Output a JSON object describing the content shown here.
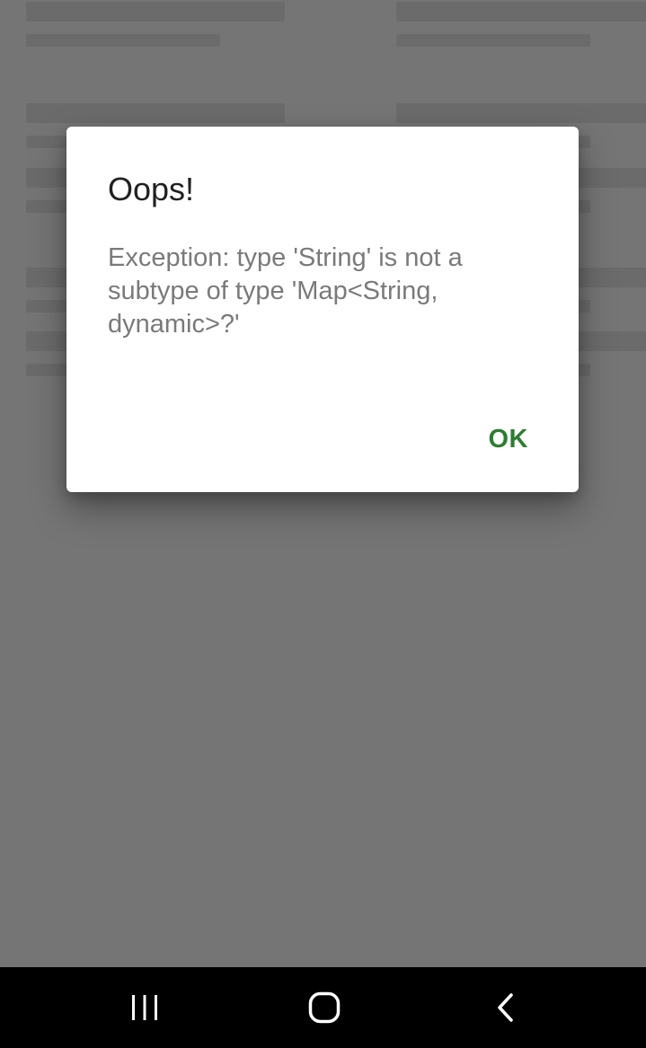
{
  "dialog": {
    "title": "Oops!",
    "message": "Exception: type 'String' is not a subtype of type 'Map<String, dynamic>?'",
    "ok_label": "OK"
  },
  "colors": {
    "scrim": "#757575",
    "dialog_bg": "#ffffff",
    "accent": "#2e7d32",
    "navbar": "#000000"
  },
  "navbar": {
    "icons": [
      "recent-apps-icon",
      "home-icon",
      "back-icon"
    ]
  }
}
